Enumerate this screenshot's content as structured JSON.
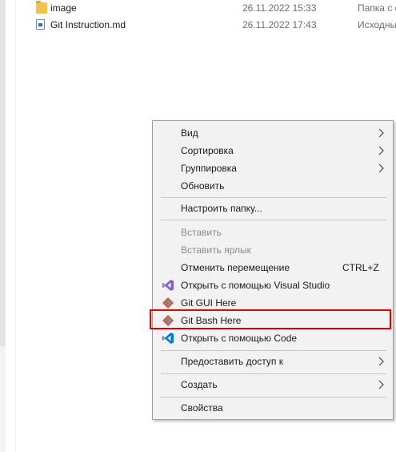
{
  "files": [
    {
      "name": "image",
      "date": "26.11.2022 15:33",
      "type": "Папка с ф",
      "icon": "folder-icon"
    },
    {
      "name": "Git Instruction.md",
      "date": "26.11.2022 17:43",
      "type": "Исходны",
      "icon": "markdown-file-icon"
    }
  ],
  "menu": {
    "view": "Вид",
    "sort": "Сортировка",
    "group": "Группировка",
    "refresh": "Обновить",
    "customize_folder": "Настроить папку...",
    "paste": "Вставить",
    "paste_shortcut": "Вставить ярлык",
    "undo_move": "Отменить перемещение",
    "undo_move_shortcut": "CTRL+Z",
    "open_visual_studio": "Открыть с помощью Visual Studio",
    "git_gui_here": "Git GUI Here",
    "git_bash_here": "Git Bash Here",
    "open_with_code": "Открыть с помощью Code",
    "give_access_to": "Предоставить доступ к",
    "new": "Создать",
    "properties": "Свойства"
  },
  "colors": {
    "highlight_border": "#e00000",
    "menu_background": "#f2f2f2",
    "visual_studio": "#8661c5",
    "vscode": "#0078d4",
    "git": "#f05133"
  }
}
